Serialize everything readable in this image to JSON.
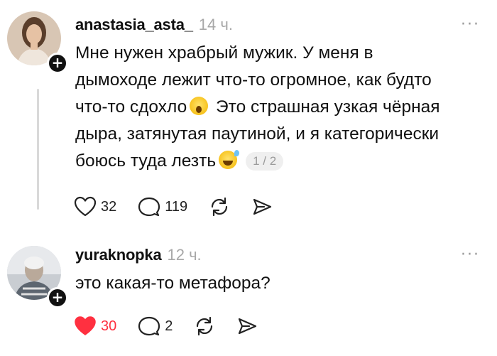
{
  "posts": [
    {
      "username": "anastasia_asta_",
      "time": "14 ч.",
      "more_icon": "ellipsis-icon",
      "text_lines": [
        "Мне нужен храбрый мужик. У меня в",
        "дымоходе лежит что-то огромное, как будто",
        "что-то сдохло",
        " Это страшная узкая чёрная",
        "дыра, затянутая паутиной, и я категорически",
        "боюсь туда лезть"
      ],
      "pager": "1 / 2",
      "likes": "32",
      "comments": "119",
      "liked": false
    },
    {
      "username": "yuraknopka",
      "time": "12 ч.",
      "more_icon": "ellipsis-icon",
      "text_lines": [
        "это какая-то метафора?"
      ],
      "likes": "30",
      "comments": "2",
      "liked": true
    }
  ],
  "colors": {
    "like_active": "#ff3040",
    "muted": "#a8a8a8",
    "text": "#111111"
  }
}
